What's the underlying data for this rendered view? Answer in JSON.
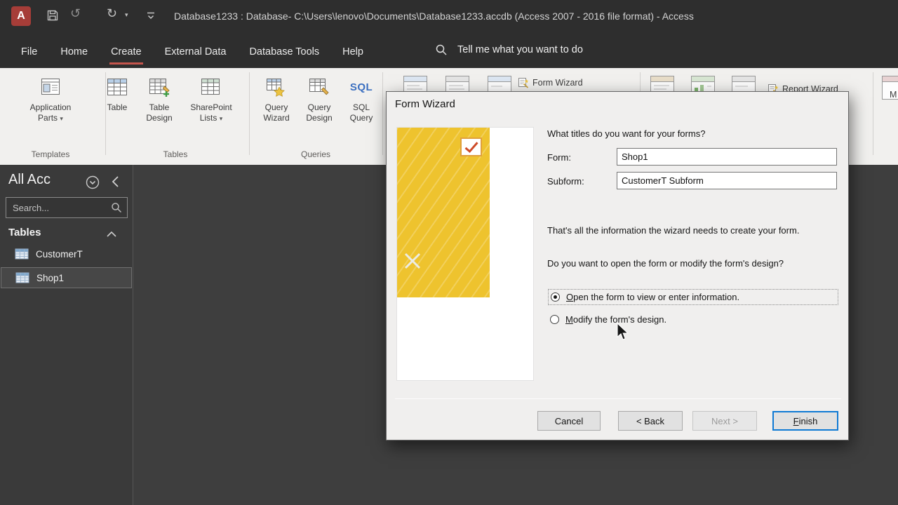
{
  "colors": {
    "titlebar-bg": "#2e2e2e",
    "ribbon-bg": "#f1f0ee",
    "main-bg": "#3e3e3e",
    "pane-bg": "#3a3a3a",
    "accent-red": "#c4554c",
    "logo-red": "#a63d38",
    "finish-blue": "#0f7ad4",
    "preview-yellow": "#eec32e",
    "sql-blue": "#3b6fc0",
    "dialog-bg": "#f0efee"
  },
  "icons": {
    "access_logo": "A",
    "undo": "↺",
    "redo": "↻",
    "caret_down": "▾",
    "sql": "SQL"
  },
  "titlebar": {
    "title": "Database1233 : Database- C:\\Users\\lenovo\\Documents\\Database1233.accdb (Access 2007 - 2016 file format)  -  Access"
  },
  "menu": {
    "tabs": [
      {
        "label": "File"
      },
      {
        "label": "Home"
      },
      {
        "label": "Create"
      },
      {
        "label": "External Data"
      },
      {
        "label": "Database Tools"
      },
      {
        "label": "Help"
      }
    ],
    "tell_me": "Tell me what you want to do"
  },
  "ribbon": {
    "groups": [
      {
        "label": "Templates",
        "buttons": [
          {
            "label": "Application Parts"
          }
        ]
      },
      {
        "label": "Tables",
        "buttons": [
          {
            "label": "Table"
          },
          {
            "label": "Table Design"
          },
          {
            "label": "SharePoint Lists"
          }
        ]
      },
      {
        "label": "Queries",
        "buttons": [
          {
            "label": "Query Wizard"
          },
          {
            "label": "Query Design"
          },
          {
            "label": "SQL Query"
          }
        ]
      }
    ],
    "form_wizard_label": "Form Wizard",
    "report_wizard_label": "Report Wizard",
    "partial_label": "M"
  },
  "nav_pane": {
    "title": "All Acc",
    "search_placeholder": "Search...",
    "section_label": "Tables",
    "items": [
      {
        "label": "CustomerT",
        "selected": false
      },
      {
        "label": "Shop1",
        "selected": true
      }
    ]
  },
  "dialog": {
    "title": "Form Wizard",
    "question_titles": "What titles do you want for your forms?",
    "form_label": "Form:",
    "form_value": "Shop1",
    "subform_label": "Subform:",
    "subform_value": "CustomerT Subform",
    "info_text": "That's all the information the wizard needs to create your form.",
    "question_open": "Do you want to open the form or modify the form's design?",
    "radio_options": [
      {
        "label": "Open the form to view or enter information.",
        "selected": true
      },
      {
        "label": "Modify the form's design.",
        "selected": false
      }
    ],
    "buttons": [
      {
        "label": "Cancel",
        "enabled": true
      },
      {
        "label": "< Back",
        "enabled": true
      },
      {
        "label": "Next >",
        "enabled": false
      },
      {
        "label": "Finish",
        "enabled": true,
        "default": true
      }
    ]
  }
}
